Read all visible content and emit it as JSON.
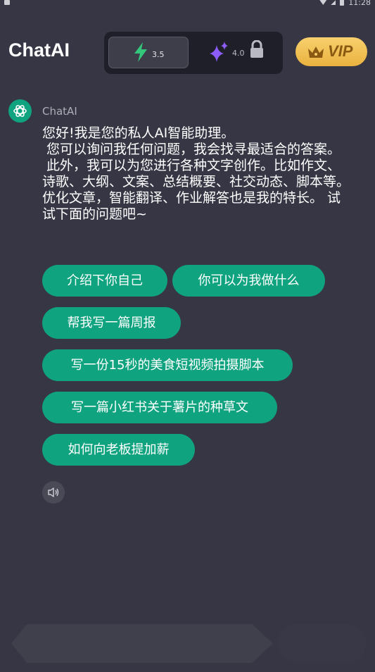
{
  "status": {
    "time": "11:28"
  },
  "header": {
    "title": "ChatAI",
    "models": [
      {
        "version": "3.5",
        "icon": "lightning-icon",
        "selected": true
      },
      {
        "version": "4.0",
        "icon": "sparkle-icon",
        "locked": true
      }
    ],
    "vip_label": "VIP"
  },
  "chat": {
    "sender": "ChatAI",
    "message": "您好!我是您的私人AI智能助理。\n 您可以询问我任何问题，我会找寻最适合的答案。\n 此外，我可以为您进行各种文字创作。比如作文、诗歌、大纲、文案、总结概要、社交动态、脚本等。\n优化文章，智能翻译、作业解答也是我的特长。 试试下面的问题吧~",
    "suggestions": [
      "介绍下你自己",
      "你可以为我做什么",
      "帮我写一篇周报",
      "写一份15秒的美食短视频拍摄脚本",
      "写一篇小红书关于薯片的种草文",
      "如何向老板提加薪"
    ]
  },
  "colors": {
    "background": "#363644",
    "accent": "#10a37f",
    "vip_gold": "#f5c451",
    "lightning_green": "#34c77b",
    "sparkle_purple": "#8b5cf6"
  }
}
